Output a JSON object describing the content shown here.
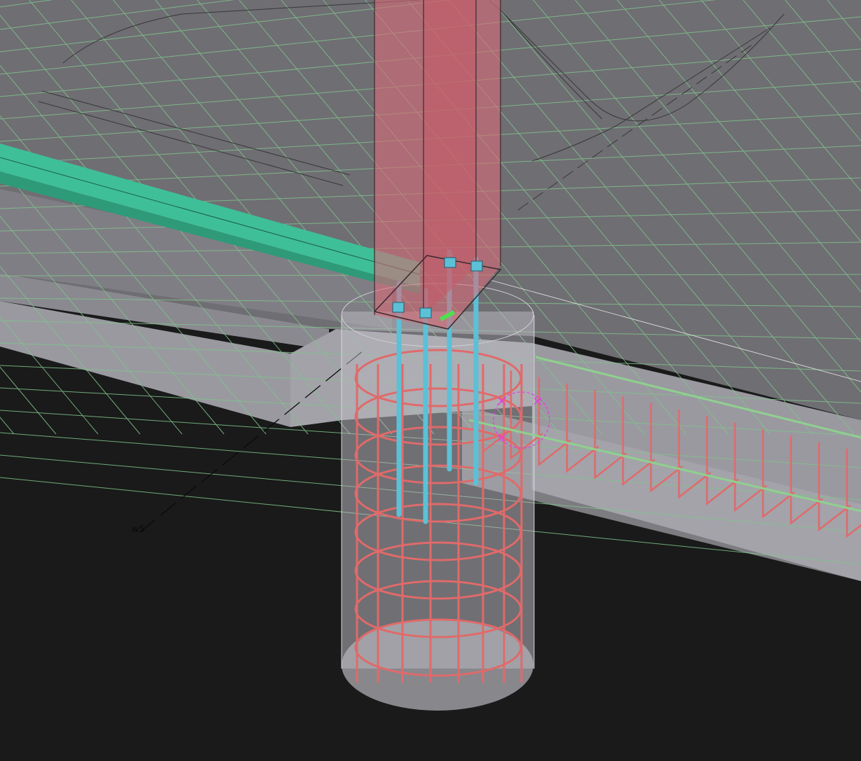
{
  "viewport": {
    "background": "#1a1a1a",
    "slab_color": "#6f6e73",
    "grid_color": "#7fc48a",
    "column_color": "#d96a78",
    "purlin_color": "#3fbf97",
    "rebar_color": "#e06a6a",
    "bolt_color": "#5cc0d6",
    "concrete_color": "#b8b6bd",
    "pick_marker_color": "#e040e0"
  },
  "grid_line_label": "w5"
}
